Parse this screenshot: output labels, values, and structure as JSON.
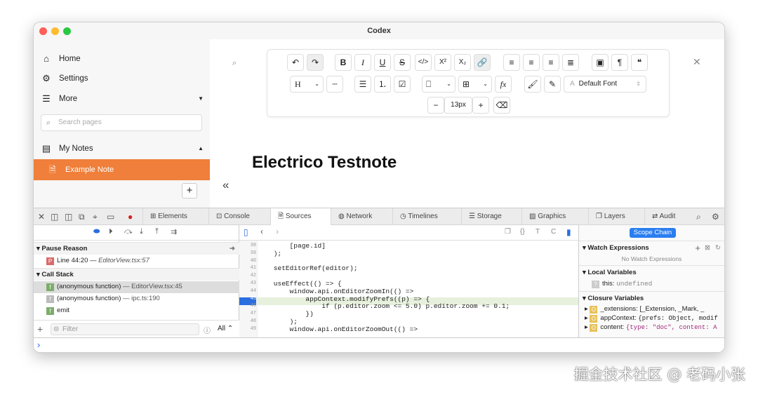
{
  "window": {
    "title": "Codex"
  },
  "sidebar": {
    "items": [
      {
        "label": "Home",
        "icon": "home-icon"
      },
      {
        "label": "Settings",
        "icon": "gear-icon"
      },
      {
        "label": "More",
        "icon": "menu-icon"
      }
    ],
    "search_placeholder": "Search pages",
    "section": "My Notes",
    "active_note": "Example Note",
    "add_label": "+"
  },
  "editor": {
    "font": "Default Font",
    "font_size": "13px",
    "title": "Electrico Testnote",
    "collapse": "«"
  },
  "devtools": {
    "tabs": [
      "Elements",
      "Console",
      "Sources",
      "Network",
      "Timelines",
      "Storage",
      "Graphics",
      "Layers",
      "Audit"
    ],
    "selected_tab": "Sources",
    "pause_reason": {
      "header": "Pause Reason",
      "line": "Line 44:20 — ",
      "file": "EditorView.tsx:57"
    },
    "call_stack": {
      "header": "Call Stack",
      "frames": [
        {
          "name": "(anonymous function)",
          "loc": " — EditorView.tsx:45"
        },
        {
          "name": "(anonymous function)",
          "loc": " — ipc.ts:190"
        },
        {
          "name": "emit",
          "loc": ""
        }
      ]
    },
    "filter_placeholder": "Filter",
    "filter_all": "All ⌃",
    "code": [
      {
        "n": "38",
        "t": "        [page.id]"
      },
      {
        "n": "39",
        "t": "    );"
      },
      {
        "n": "40",
        "t": ""
      },
      {
        "n": "41",
        "t": "    setEditorRef(editor);"
      },
      {
        "n": "42",
        "t": ""
      },
      {
        "n": "43",
        "t": "    useEffect(() => {"
      },
      {
        "n": "44",
        "t": "        window.api.onEditorZoomIn(() =>"
      },
      {
        "n": "45",
        "t": "            appContext.modifyPrefs((p) => {"
      },
      {
        "n": "46",
        "t": "                if (p.editor.zoom <= 5.0) p.editor.zoom += 0.1;"
      },
      {
        "n": "47",
        "t": "            })"
      },
      {
        "n": "48",
        "t": "        );"
      },
      {
        "n": "49",
        "t": "        window.api.onEditorZoomOut(() =>"
      }
    ],
    "scope_chain": "Scope Chain",
    "watch": {
      "header": "Watch Expressions",
      "empty": "No Watch Expressions"
    },
    "local": {
      "header": "Local Variables",
      "key": "this:",
      "value": "undefined"
    },
    "closure": {
      "header": "Closure Variables",
      "items": [
        {
          "key": "_extensions:",
          "value": "[_Extension, _Mark, _"
        },
        {
          "key": "appContext:",
          "value": "{prefs: Object, modif"
        },
        {
          "key": "content:",
          "value": "{type: \"doc\", content: A"
        }
      ]
    },
    "console_prompt": "›"
  },
  "watermark": "掘金技术社区 @ 老码小张"
}
